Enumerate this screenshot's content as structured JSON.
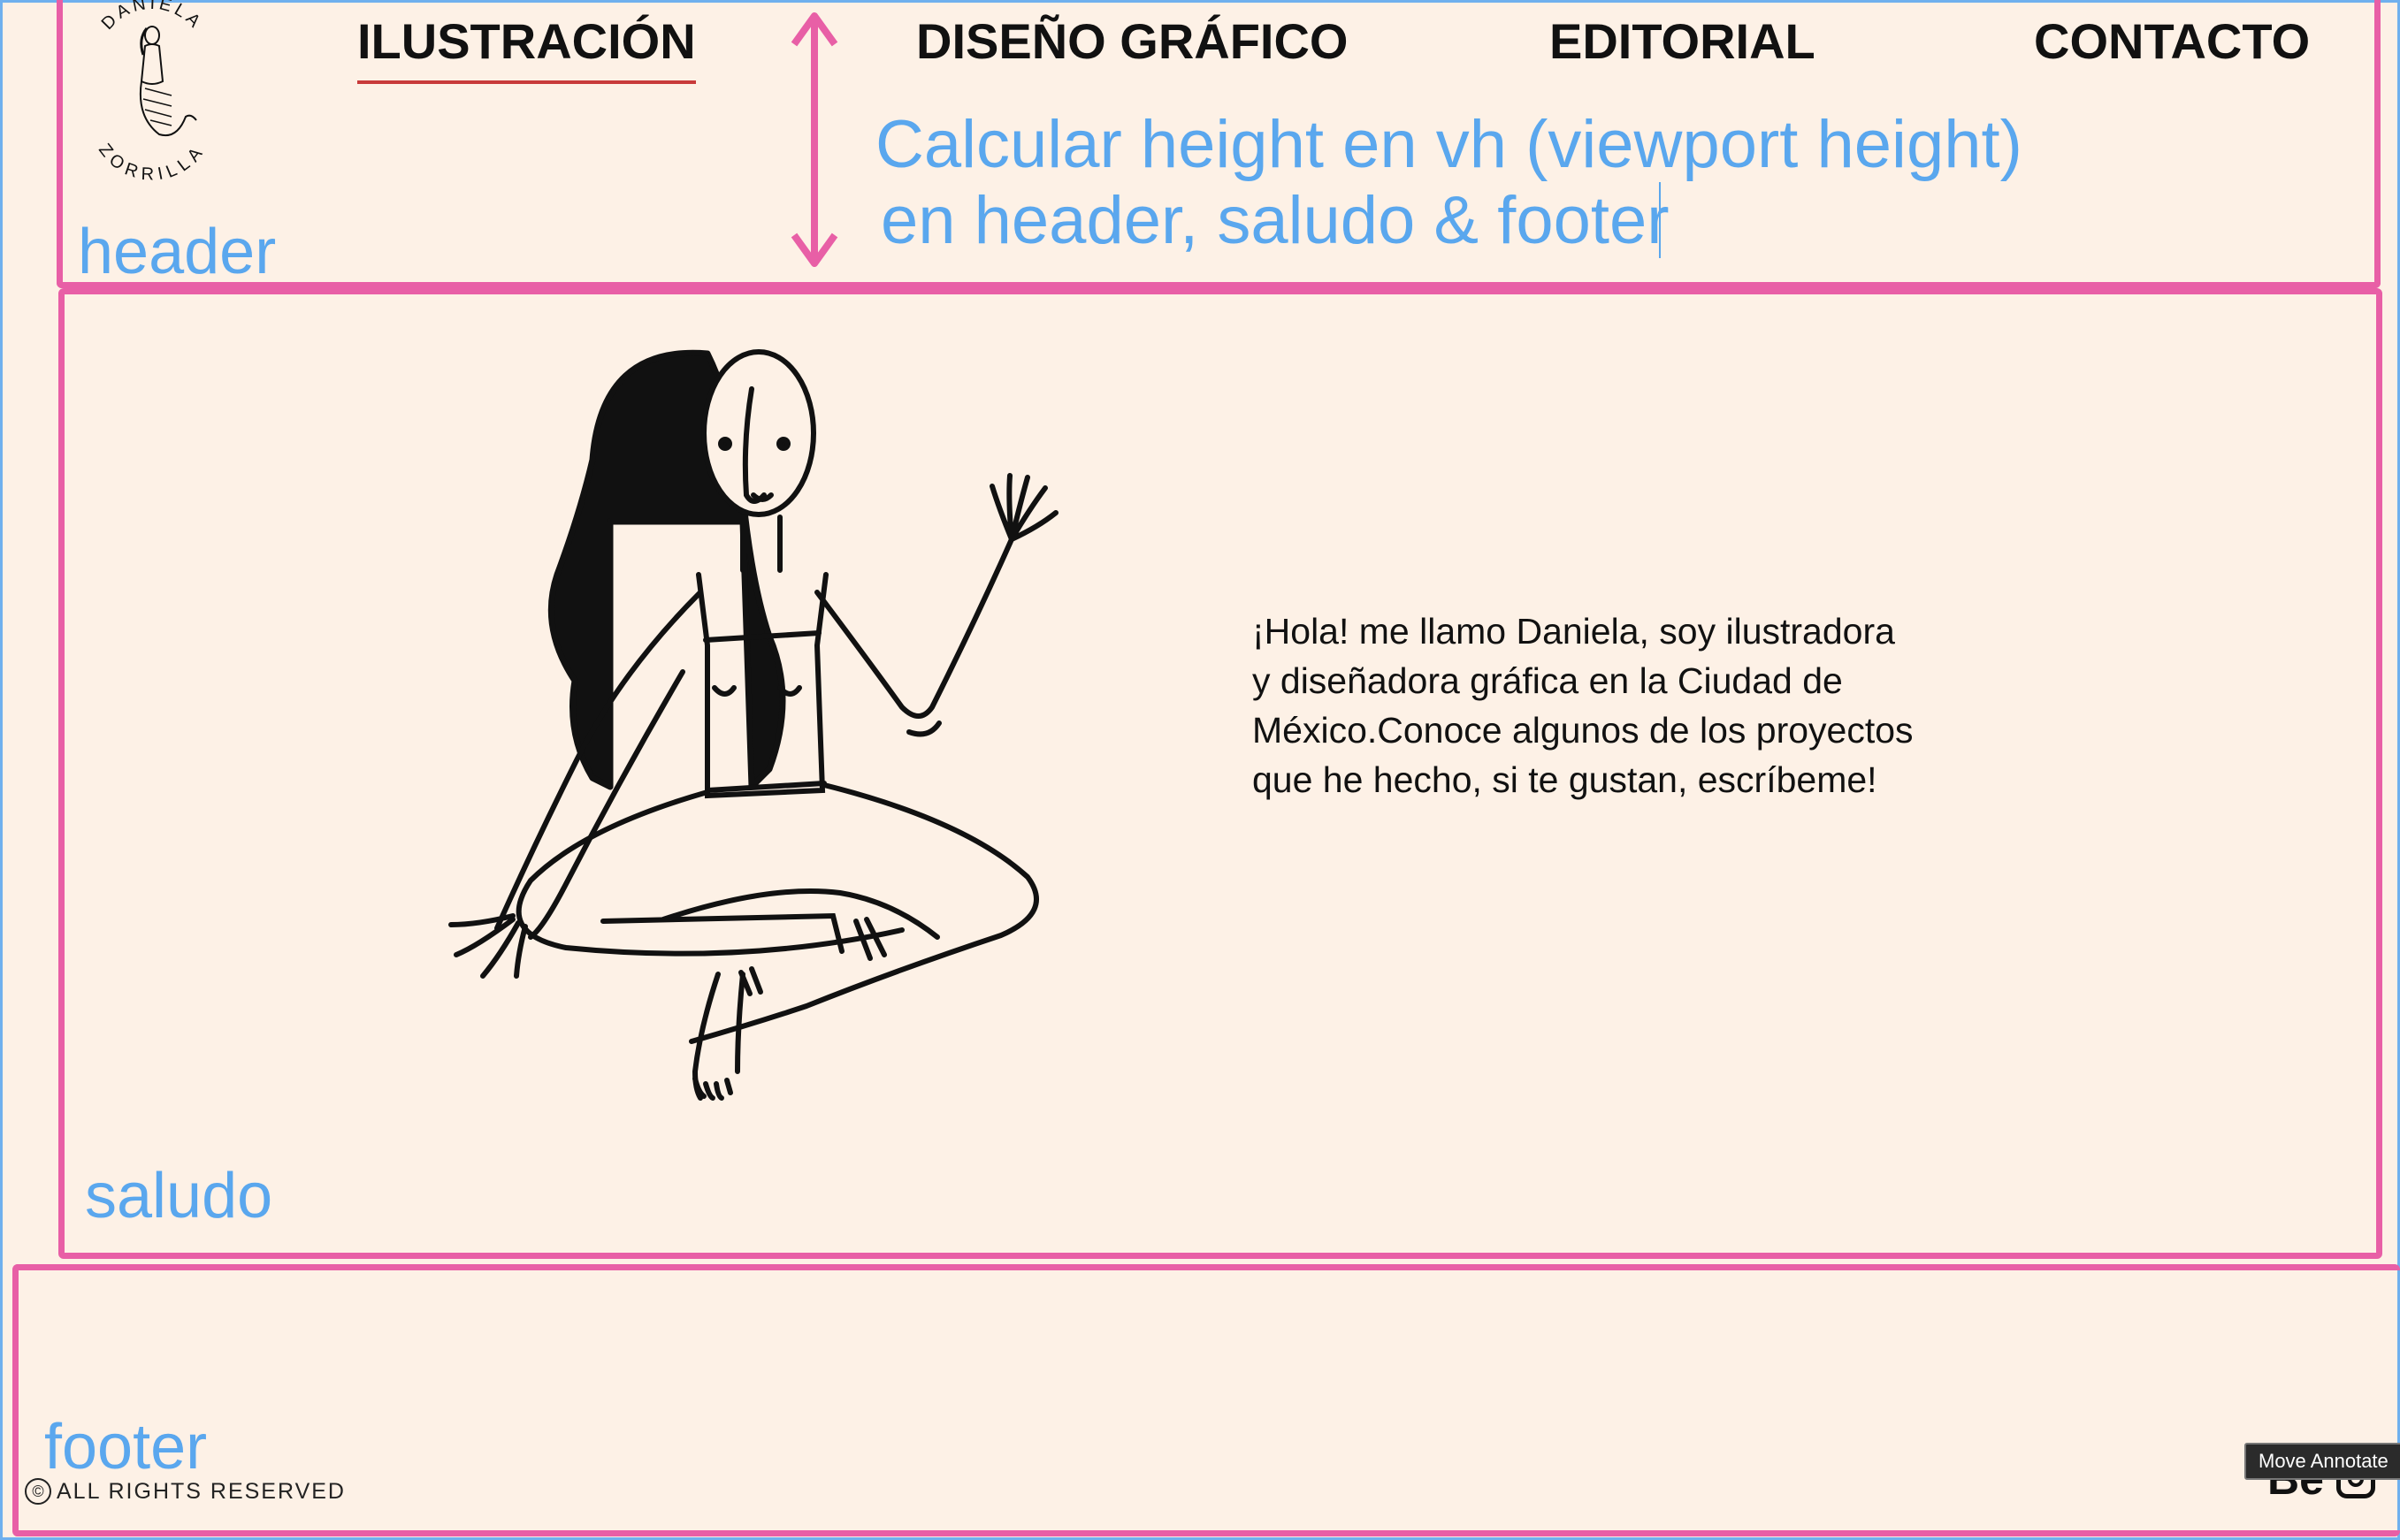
{
  "nav": {
    "items": [
      {
        "label": "ILUSTRACIÓN",
        "active": true
      },
      {
        "label": "DISEÑO GRÁFICO",
        "active": false
      },
      {
        "label": "EDITORIAL",
        "active": false
      },
      {
        "label": "CONTACTO",
        "active": false
      }
    ]
  },
  "logo": {
    "text_top": "DANIELA",
    "text_bottom": "ZORRILLA"
  },
  "annotations": {
    "header": "header",
    "saludo": "saludo",
    "footer": "footer",
    "note_line1": "Calcular height en vh (viewport height)",
    "note_line2": "en header, saludo & footer"
  },
  "saludo": {
    "intro_lines": [
      "¡Hola! me llamo Daniela, soy ilustradora",
      "y diseñadora gráfica en la Ciudad de",
      "México.Conoce algunos de los proyectos",
      "que he hecho, si te gustan, escríbeme!"
    ]
  },
  "footer": {
    "copyright_symbol": "©",
    "copyright_text": "ALL RIGHTS RESERVED",
    "social": [
      "behance-icon",
      "instagram-icon"
    ],
    "behance_label": "Be"
  },
  "tooltip": {
    "label": "Move Annotate"
  },
  "colors": {
    "background": "#fdf1e6",
    "annotation_box": "#e85fa6",
    "annotation_text": "#5aa7ee",
    "active_underline": "#c83a3a"
  }
}
